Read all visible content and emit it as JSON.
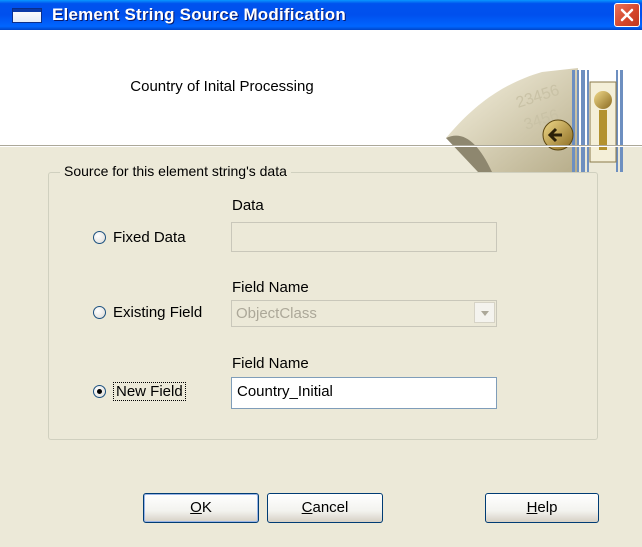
{
  "window": {
    "title": "Element String Source Modification",
    "close_symbol": "close-icon"
  },
  "header": {
    "subtitle": "Country of Inital Processing"
  },
  "group": {
    "label": "Source for this element string's data"
  },
  "options": [
    {
      "label": "Fixed Data",
      "checked": false,
      "field_label": "Data",
      "value": "",
      "enabled": false
    },
    {
      "label": "Existing Field",
      "checked": false,
      "field_label": "Field Name",
      "value": "ObjectClass",
      "enabled": false
    },
    {
      "label": "New Field",
      "checked": true,
      "field_label": "Field Name",
      "value": "Country_Initial",
      "enabled": true
    }
  ],
  "buttons": {
    "ok": {
      "mnemonic": "O",
      "rest": "K"
    },
    "cancel": {
      "mnemonic": "C",
      "rest": "ancel"
    },
    "help": {
      "mnemonic": "H",
      "rest": "elp"
    }
  },
  "colors": {
    "titlebar": "#0053ee",
    "dialog_bg": "#ece9d8",
    "close": "#d3452a"
  }
}
